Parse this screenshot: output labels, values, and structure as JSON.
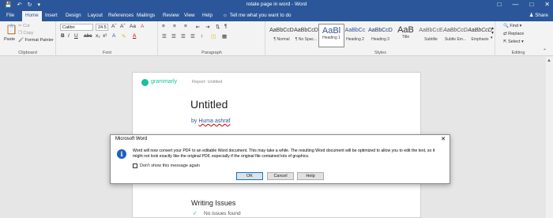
{
  "title_bar": {
    "doc_title": "rotate page in word  -  Word",
    "qat": [
      "save-icon",
      "undo-icon",
      "redo-icon",
      "customize-icon"
    ]
  },
  "tabs": [
    "File",
    "Home",
    "Insert",
    "Design",
    "Layout",
    "References",
    "Mailings",
    "Review",
    "View",
    "Help"
  ],
  "active_tab": "Home",
  "tell_me": "Tell me what you want to do",
  "share": "Share",
  "clipboard": {
    "paste": "Paste",
    "cut": "Cut",
    "copy": "Copy",
    "format_painter": "Format Painter",
    "label": "Clipboard"
  },
  "font": {
    "name": "Calibri",
    "size": "24.5",
    "label": "Font"
  },
  "paragraph": {
    "label": "Paragraph"
  },
  "styles": {
    "items": [
      {
        "sample": "AaBbCcD",
        "name": "¶ Normal"
      },
      {
        "sample": "AaBbCcD",
        "name": "¶ No Spac..."
      },
      {
        "sample": "AaBl",
        "name": "Heading 1"
      },
      {
        "sample": "AaBbCc",
        "name": "Heading 2"
      },
      {
        "sample": "AaBbCcD",
        "name": "Heading 3"
      },
      {
        "sample": "AaB",
        "name": "Title"
      },
      {
        "sample": "AaBbCcE",
        "name": "Subtitle"
      },
      {
        "sample": "AaBbCcD",
        "name": "Subtle Em..."
      },
      {
        "sample": "AaBbCcD",
        "name": "Emphasis"
      }
    ],
    "label": "Styles"
  },
  "editing": {
    "find": "Find",
    "replace": "Replace",
    "select": "Select",
    "label": "Editing"
  },
  "document": {
    "grammarly": "grammarly",
    "report": "Report: Untitled",
    "heading": "Untitled",
    "by": "by",
    "author": "Huma ashraf",
    "section": "Writing Issues",
    "no_issues": "No issues found"
  },
  "dialog": {
    "title": "Microsoft Word",
    "message": "Word will now convert your PDF to an editable Word document. This may take a while. The resulting Word document will be optimized to allow you to edit the text, so it might not look exactly like the original PDF, especially if the original file contained lots of graphics.",
    "checkbox": "Don't show this message again",
    "ok": "OK",
    "cancel": "Cancel",
    "help": "Help"
  },
  "colors": {
    "accent": "#2b579a",
    "grammarly": "#15c39a",
    "dialog_icon": "#1f5fbf"
  }
}
